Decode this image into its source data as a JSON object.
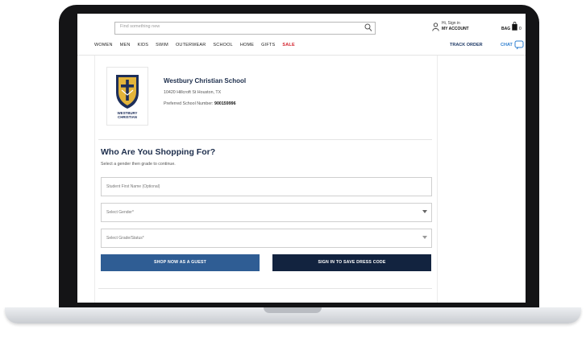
{
  "header": {
    "search_placeholder": "Find something new",
    "greeting": "Hi, Sign in",
    "account_label": "MY ACCOUNT",
    "bag_label": "BAG",
    "bag_count": "0"
  },
  "nav": {
    "items": [
      "WOMEN",
      "MEN",
      "KIDS",
      "SWIM",
      "OUTERWEAR",
      "SCHOOL",
      "HOME",
      "GIFTS",
      "SALE"
    ],
    "track_order": "TRACK ORDER",
    "chat": "CHAT"
  },
  "school": {
    "logo_text": "WESTBURY CHRISTIAN",
    "name": "Westbury Christian School",
    "address": "10420 Hillcroft St Houston, TX",
    "number_label": "Preferred School Number:",
    "number": "900159996"
  },
  "shopping": {
    "heading": "Who Are You Shopping For?",
    "instructions": "Select a gender then grade to continue.",
    "student_name_placeholder": "Student First Name (Optional)",
    "gender_placeholder": "Select Gender*",
    "grade_placeholder": "Select Grade/Status*",
    "guest_button": "SHOP NOW AS A GUEST",
    "signin_button": "SIGN IN TO SAVE DRESS CODE"
  },
  "colors": {
    "brand_navy": "#1d2e4c",
    "guest_blue": "#2f5d94",
    "signin_navy": "#12233f",
    "sale_red": "#d21f2a",
    "chat_blue": "#2e7fd0"
  }
}
